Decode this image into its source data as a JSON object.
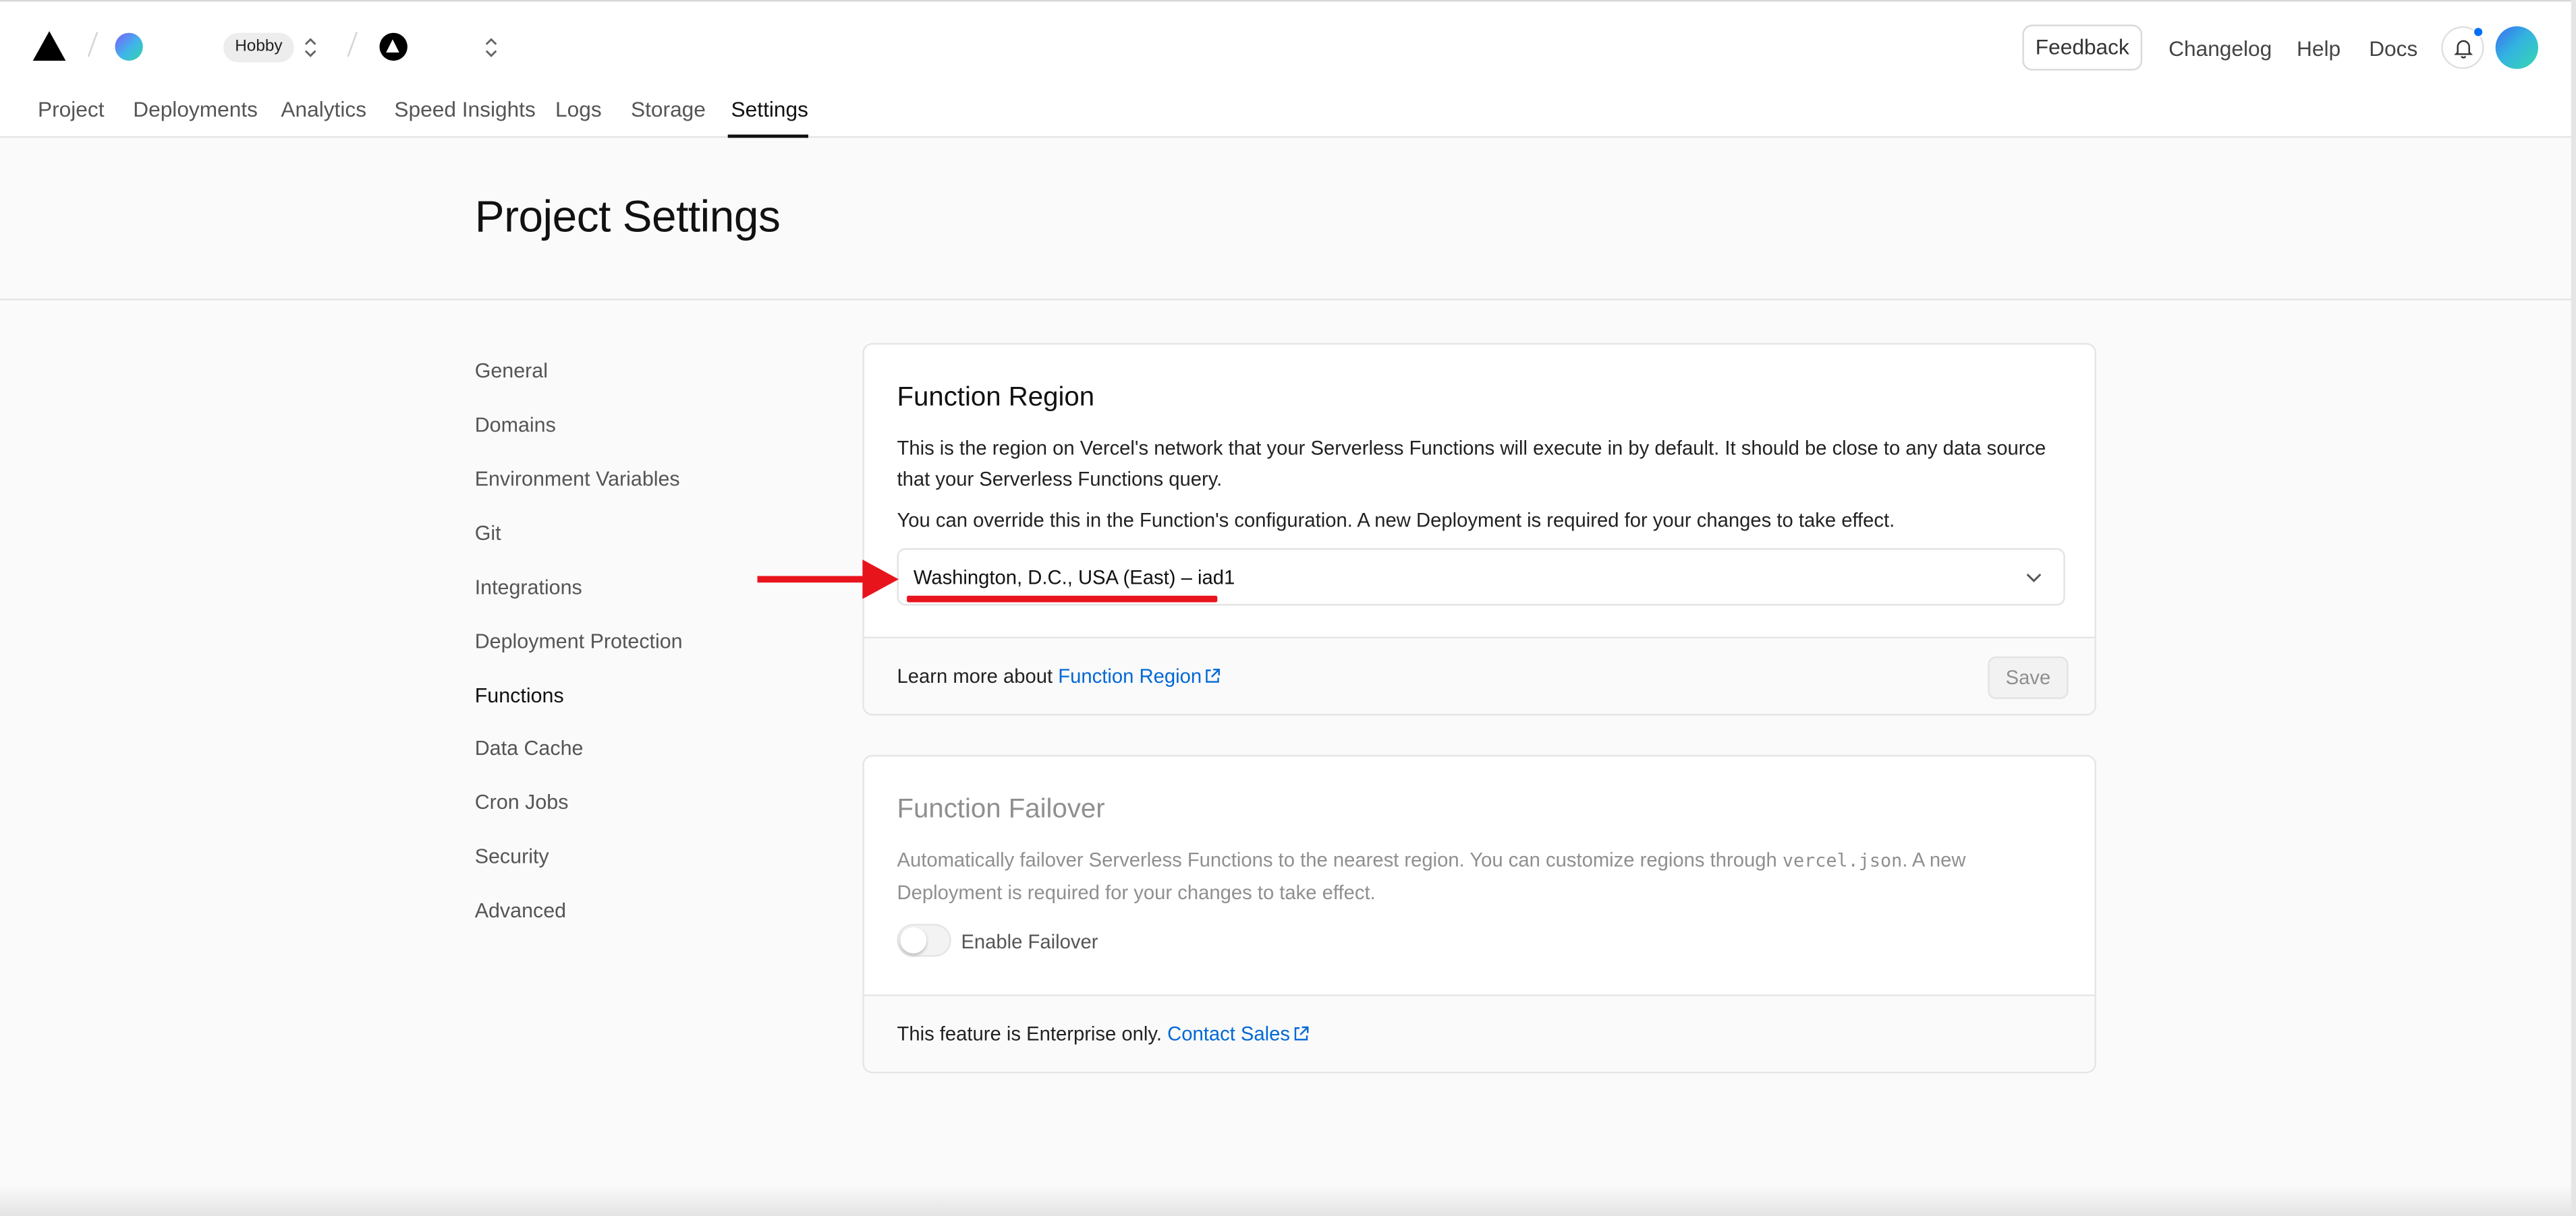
{
  "header": {
    "plan_badge": "Hobby",
    "feedback": "Feedback",
    "links": [
      "Changelog",
      "Help",
      "Docs"
    ]
  },
  "tabs": [
    "Project",
    "Deployments",
    "Analytics",
    "Speed Insights",
    "Logs",
    "Storage",
    "Settings"
  ],
  "active_tab": "Settings",
  "page_title": "Project Settings",
  "sidebar": {
    "items": [
      "General",
      "Domains",
      "Environment Variables",
      "Git",
      "Integrations",
      "Deployment Protection",
      "Functions",
      "Data Cache",
      "Cron Jobs",
      "Security",
      "Advanced"
    ],
    "active": "Functions"
  },
  "function_region": {
    "title": "Function Region",
    "description": "This is the region on Vercel's network that your Serverless Functions will execute in by default. It should be close to any data source that your Serverless Functions query.",
    "override_note": "You can override this in the Function's configuration. A new Deployment is required for your changes to take effect.",
    "selected_region": "Washington, D.C., USA (East) – iad1",
    "learn_more_prefix": "Learn more about",
    "learn_more_link": "Function Region",
    "save_label": "Save"
  },
  "function_failover": {
    "title": "Function Failover",
    "description_start": "Automatically failover Serverless Functions to the nearest region. You can customize regions through",
    "config_file": "vercel.json",
    "description_end": ". A new Deployment is required for your changes to take effect.",
    "toggle_label": "Enable Failover",
    "toggle_enabled": false,
    "enterprise_prefix": "This feature is Enterprise only.",
    "contact_link": "Contact Sales"
  },
  "colors": {
    "accent_link": "#0068d6",
    "annotation_red": "#e8141c",
    "notification_dot": "#0070f3"
  },
  "icons": [
    "vercel-logo-icon",
    "chevron-up-down-icon",
    "bell-icon",
    "chevron-down-icon",
    "external-link-icon",
    "red-arrow-annotation"
  ]
}
